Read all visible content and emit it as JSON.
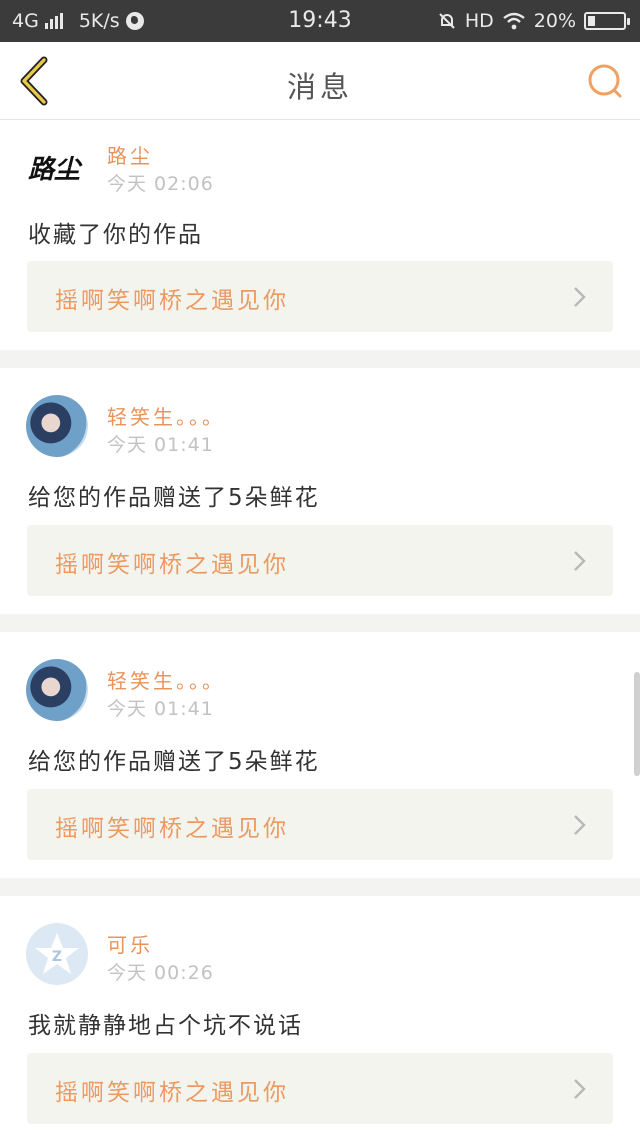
{
  "status_bar": {
    "network": "4G",
    "speed": "5K/s",
    "time": "19:43",
    "hd": "HD",
    "battery": "20%",
    "battery_level": 0.2
  },
  "nav": {
    "title": "消息",
    "back_icon": "chevron-left-icon",
    "search_icon": "search-icon"
  },
  "colors": {
    "accent_orange": "#e8935c",
    "card_bg": "#f4f4ee"
  },
  "notifications": [
    {
      "user": "路尘",
      "time": "今天 02:06",
      "message": "收藏了你的作品",
      "work_title": "摇啊笑啊桥之遇见你",
      "avatar": "calligraphy-avatar",
      "avatar_text": "路尘"
    },
    {
      "user": "轻笑生。。。",
      "time": "今天 01:41",
      "message": "给您的作品赠送了5朵鲜花",
      "work_title": "摇啊笑啊桥之遇见你",
      "avatar": "anime-girl-avatar"
    },
    {
      "user": "轻笑生。。。",
      "time": "今天 01:41",
      "message": "给您的作品赠送了5朵鲜花",
      "work_title": "摇啊笑啊桥之遇见你",
      "avatar": "anime-girl-avatar"
    },
    {
      "user": "可乐",
      "time": "今天 00:26",
      "message": "我就静静地占个坑不说话",
      "work_title": "摇啊笑啊桥之遇见你",
      "avatar": "default-qq-avatar"
    }
  ]
}
